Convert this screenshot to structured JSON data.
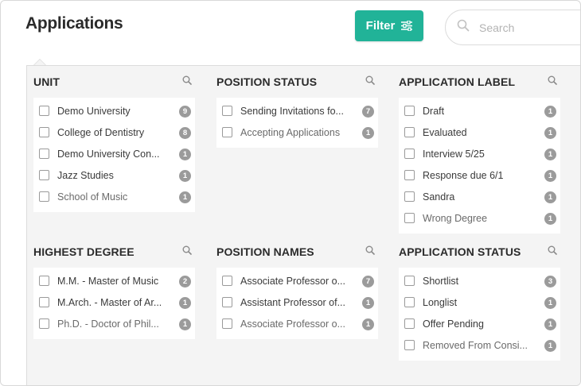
{
  "header": {
    "title": "Applications",
    "filter_label": "Filter",
    "search_placeholder": "Search"
  },
  "facets": [
    {
      "title": "UNIT",
      "items": [
        {
          "label": "Demo University",
          "count": "9"
        },
        {
          "label": "College of Dentistry",
          "count": "8"
        },
        {
          "label": "Demo University Con...",
          "count": "1"
        },
        {
          "label": "Jazz Studies",
          "count": "1"
        },
        {
          "label": "School of Music",
          "count": "1"
        }
      ]
    },
    {
      "title": "POSITION STATUS",
      "items": [
        {
          "label": "Sending Invitations fo...",
          "count": "7"
        },
        {
          "label": "Accepting Applications",
          "count": "1"
        }
      ]
    },
    {
      "title": "APPLICATION LABEL",
      "items": [
        {
          "label": "Draft",
          "count": "1"
        },
        {
          "label": "Evaluated",
          "count": "1"
        },
        {
          "label": "Interview 5/25",
          "count": "1"
        },
        {
          "label": "Response due 6/1",
          "count": "1"
        },
        {
          "label": "Sandra",
          "count": "1"
        },
        {
          "label": "Wrong Degree",
          "count": "1"
        }
      ]
    },
    {
      "title": "HIGHEST DEGREE",
      "items": [
        {
          "label": "M.M. - Master of Music",
          "count": "2"
        },
        {
          "label": "M.Arch. - Master of Ar...",
          "count": "1"
        },
        {
          "label": "Ph.D. - Doctor of Phil...",
          "count": "1"
        }
      ]
    },
    {
      "title": "POSITION NAMES",
      "items": [
        {
          "label": "Associate Professor o...",
          "count": "7"
        },
        {
          "label": "Assistant Professor of...",
          "count": "1"
        },
        {
          "label": "Associate Professor o...",
          "count": "1"
        }
      ]
    },
    {
      "title": "APPLICATION STATUS",
      "items": [
        {
          "label": "Shortlist",
          "count": "3"
        },
        {
          "label": "Longlist",
          "count": "1"
        },
        {
          "label": "Offer Pending",
          "count": "1"
        },
        {
          "label": "Removed From Consi...",
          "count": "1"
        }
      ]
    }
  ],
  "colors": {
    "accent": "#21b398",
    "panel_bg": "#f4f4f4",
    "badge": "#9b9b9b"
  }
}
